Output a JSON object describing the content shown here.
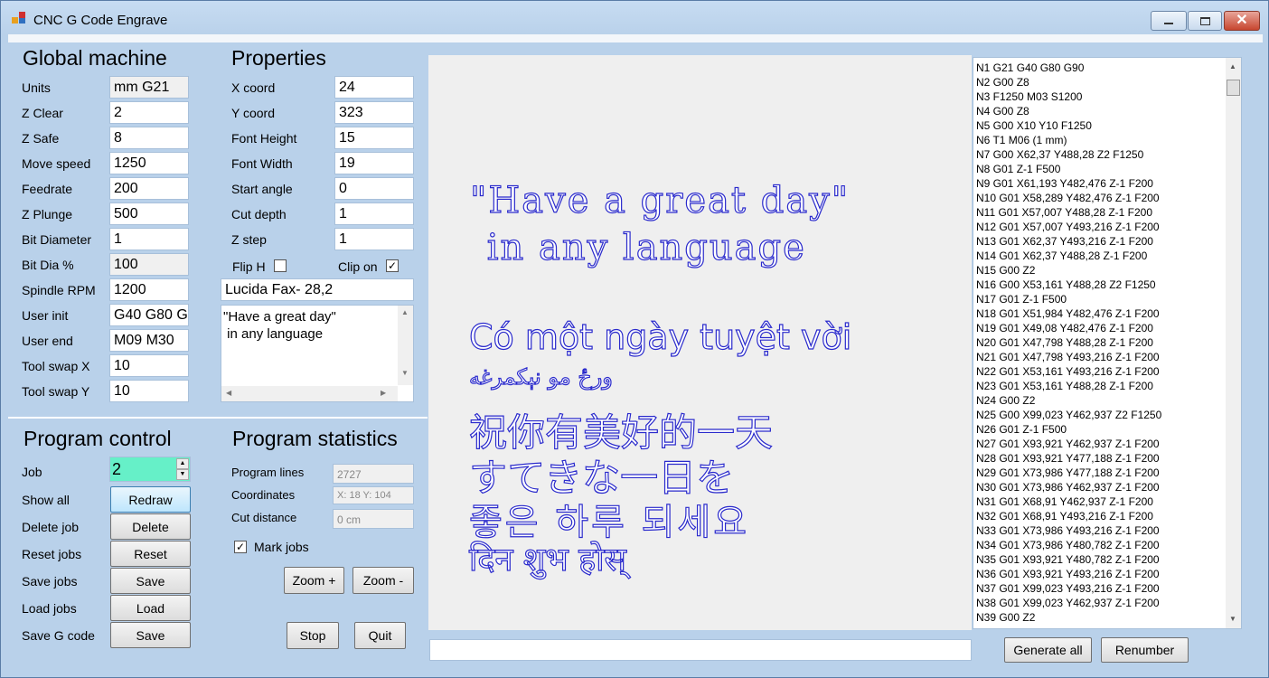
{
  "window": {
    "title": "CNC G Code Engrave",
    "buttons": {
      "minimize": "minimize-icon",
      "maximize": "maximize-icon",
      "close": "close-icon"
    }
  },
  "global_machine": {
    "heading": "Global machine",
    "fields": [
      {
        "label": "Units",
        "value": "mm G21"
      },
      {
        "label": "Z Clear",
        "value": "2"
      },
      {
        "label": "Z Safe",
        "value": "8"
      },
      {
        "label": "Move speed",
        "value": "1250"
      },
      {
        "label": "Feedrate",
        "value": "200"
      },
      {
        "label": "Z Plunge",
        "value": "500"
      },
      {
        "label": "Bit Diameter",
        "value": "1"
      },
      {
        "label": "Bit Dia %",
        "value": "100"
      },
      {
        "label": "Spindle RPM",
        "value": "1200"
      },
      {
        "label": "User init",
        "value": "G40 G80 G"
      },
      {
        "label": "User end",
        "value": "M09 M30"
      },
      {
        "label": "Tool swap X",
        "value": "10"
      },
      {
        "label": "Tool swap Y",
        "value": "10"
      }
    ]
  },
  "properties": {
    "heading": "Properties",
    "fields": [
      {
        "label": "X coord",
        "value": "24"
      },
      {
        "label": "Y coord",
        "value": "323"
      },
      {
        "label": "Font Height",
        "value": "15"
      },
      {
        "label": "Font Width",
        "value": "19"
      },
      {
        "label": "Start angle",
        "value": "0"
      },
      {
        "label": "Cut depth",
        "value": "1"
      },
      {
        "label": "Z step",
        "value": "1"
      }
    ],
    "flip_h_label": "Flip H",
    "flip_h_checked": false,
    "clip_on_label": "Clip on",
    "clip_on_checked": true,
    "font": "Lucida Fax- 28,2",
    "text_line1": "\"Have a great day\"",
    "text_line2": " in any language"
  },
  "program_control": {
    "heading": "Program control",
    "job_label": "Job",
    "job_value": "2",
    "rows": [
      {
        "label": "Show all",
        "button": "Redraw"
      },
      {
        "label": "Delete job",
        "button": "Delete"
      },
      {
        "label": "Reset jobs",
        "button": "Reset"
      },
      {
        "label": "Save jobs",
        "button": "Save"
      },
      {
        "label": "Load jobs",
        "button": "Load"
      },
      {
        "label": "Save G code",
        "button": "Save"
      }
    ]
  },
  "program_statistics": {
    "heading": "Program statistics",
    "program_lines_label": "Program lines",
    "program_lines": "2727",
    "coordinates_label": "Coordinates",
    "coordinates": "X: 18  Y: 104",
    "cut_distance_label": "Cut distance",
    "cut_distance": "0 cm",
    "mark_jobs_label": "Mark jobs",
    "mark_jobs_checked": true,
    "zoom_in": "Zoom +",
    "zoom_out": "Zoom -",
    "stop": "Stop",
    "quit": "Quit"
  },
  "preview": {
    "lines": [
      "\"Have a great day\"",
      " in any language",
      "Có một ngày tuyệt vời",
      "ورځ مو نېکمرغه",
      "祝你有美好的一天",
      "すてきな一日を",
      "좋은 하루 되세요",
      "दिन शुभ होस्"
    ],
    "stroke_color": "#2a2acc"
  },
  "gcode": {
    "lines": [
      "N1 G21 G40 G80 G90",
      "N2 G00 Z8",
      "N3  F1250 M03 S1200",
      "N4 G00 Z8",
      "N5 G00 X10 Y10 F1250",
      "N6 T1 M06 (1 mm)",
      "N7 G00 X62,37 Y488,28 Z2 F1250",
      "N8 G01 Z-1 F500",
      "N9 G01 X61,193 Y482,476 Z-1 F200",
      "N10 G01 X58,289 Y482,476 Z-1 F200",
      "N11 G01 X57,007 Y488,28 Z-1 F200",
      "N12 G01 X57,007 Y493,216 Z-1 F200",
      "N13 G01 X62,37 Y493,216 Z-1 F200",
      "N14 G01 X62,37 Y488,28 Z-1 F200",
      "N15 G00 Z2",
      "N16 G00 X53,161 Y488,28 Z2 F1250",
      "N17 G01 Z-1 F500",
      "N18 G01 X51,984 Y482,476 Z-1 F200",
      "N19 G01 X49,08 Y482,476 Z-1 F200",
      "N20 G01 X47,798 Y488,28 Z-1 F200",
      "N21 G01 X47,798 Y493,216 Z-1 F200",
      "N22 G01 X53,161 Y493,216 Z-1 F200",
      "N23 G01 X53,161 Y488,28 Z-1 F200",
      "N24 G00 Z2",
      "N25 G00 X99,023 Y462,937 Z2 F1250",
      "N26 G01 Z-1 F500",
      "N27 G01 X93,921 Y462,937 Z-1 F200",
      "N28 G01 X93,921 Y477,188 Z-1 F200",
      "N29 G01 X73,986 Y477,188 Z-1 F200",
      "N30 G01 X73,986 Y462,937 Z-1 F200",
      "N31 G01 X68,91 Y462,937 Z-1 F200",
      "N32 G01 X68,91 Y493,216 Z-1 F200",
      "N33 G01 X73,986 Y493,216 Z-1 F200",
      "N34 G01 X73,986 Y480,782 Z-1 F200",
      "N35 G01 X93,921 Y480,782 Z-1 F200",
      "N36 G01 X93,921 Y493,216 Z-1 F200",
      "N37 G01 X99,023 Y493,216 Z-1 F200",
      "N38 G01 X99,023 Y462,937 Z-1 F200",
      "N39 G00 Z2"
    ]
  },
  "bottom": {
    "status_text": "",
    "generate_all": "Generate all",
    "renumber": "Renumber"
  }
}
